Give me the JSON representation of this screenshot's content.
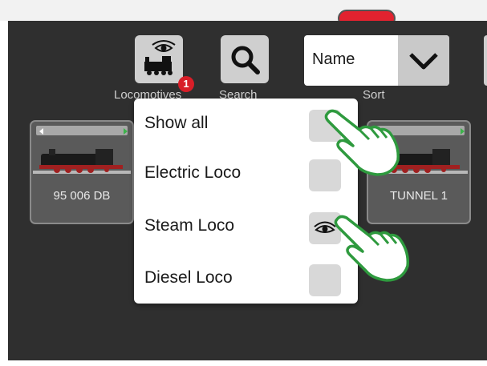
{
  "toolbar": {
    "locomotives_label": "Locomotives",
    "locomotives_badge": "1",
    "search_label": "Search",
    "sort_label": "Sort",
    "sort_value": "Name"
  },
  "locos": [
    {
      "name": "95 006 DB"
    },
    {
      "name": "TUNNEL 1"
    }
  ],
  "filter_menu": {
    "items": [
      {
        "label": "Show all",
        "checked": false
      },
      {
        "label": "Electric Loco",
        "checked": false
      },
      {
        "label": "Steam Loco",
        "checked": true,
        "icon": "eye-icon"
      },
      {
        "label": "Diesel Loco",
        "checked": false
      }
    ]
  },
  "colors": {
    "screen_bg": "#2f2f2f",
    "button_bg": "#cfcfcf",
    "badge": "#d81e28",
    "hand_outline": "#2e9a3e"
  }
}
